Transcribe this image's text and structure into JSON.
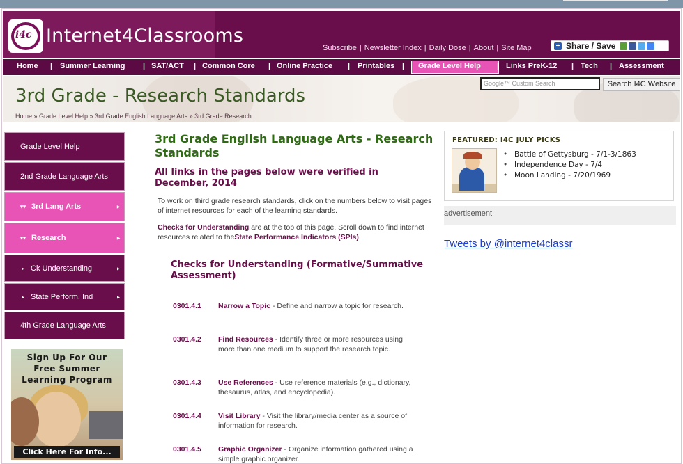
{
  "site": {
    "logo_mark": "i4c",
    "logo_text": "Internet4Classrooms"
  },
  "toplinks": [
    "Subscribe",
    "Newsletter Index",
    "Daily Dose",
    "About",
    "Site Map"
  ],
  "share_label": "Share / Save",
  "nav": [
    {
      "label": "Home",
      "active": false
    },
    {
      "label": "Summer Learning",
      "active": false
    },
    {
      "label": "SAT/ACT",
      "active": false
    },
    {
      "label": "Common Core",
      "active": false
    },
    {
      "label": "Online Practice",
      "active": false
    },
    {
      "label": "Printables",
      "active": false
    },
    {
      "label": "Grade Level Help",
      "active": true
    },
    {
      "label": "Links PreK-12",
      "active": false
    },
    {
      "label": "Tech",
      "active": false
    },
    {
      "label": "Assessment",
      "active": false
    }
  ],
  "banner": {
    "title": "3rd Grade - Research Standards",
    "breadcrumb": "Home » Grade Level Help » 3rd Grade English Language Arts » 3rd Grade Research",
    "search_placeholder": "Google™ Custom Search",
    "search_button": "Search I4C Website"
  },
  "sidebar": [
    {
      "label": "Grade Level Help",
      "style": "plain"
    },
    {
      "label": "2nd Grade Language Arts",
      "style": "plain"
    },
    {
      "label": "3rd Lang Arts",
      "style": "pink-expanded"
    },
    {
      "label": "Research",
      "style": "pink-expanded"
    },
    {
      "label": "Ck Understanding",
      "style": "sub"
    },
    {
      "label": "State Perform. Ind",
      "style": "sub"
    },
    {
      "label": "4th Grade Language Arts",
      "style": "plain"
    }
  ],
  "promo": {
    "line1": "Sign Up For Our",
    "line2": "Free Summer",
    "line3": "Learning Program",
    "cta": "Click Here For Info..."
  },
  "main": {
    "title": "3rd Grade English Language Arts - Research Standards",
    "verified": "All links in the pages below were verified in December, 2014",
    "intro": "To work on third grade research standards, click on the numbers below to visit pages of internet resources for each of the learning standards.",
    "note_prefix": "Checks for Understanding",
    "note_mid": " are at the top of this page. Scroll down to find internet resources related to the",
    "note_link": "State Performance Indicators (SPIs)",
    "note_end": ".",
    "section_title": "Checks for Understanding (Formative/Summative Assessment)",
    "standards": [
      {
        "code": "0301.4.1",
        "name": "Narrow a Topic",
        "desc": " - Define and narrow a topic for research."
      },
      {
        "code": "0301.4.2",
        "name": "Find Resources",
        "desc": " - Identify three or more resources using more than one medium to support the research topic."
      },
      {
        "code": "0301.4.3",
        "name": "Use References",
        "desc": " - Use reference materials (e.g., dictionary, thesaurus, atlas, and encyclopedia)."
      },
      {
        "code": "0301.4.4",
        "name": "Visit Library",
        "desc": " - Visit the library/media center as a source of information for research."
      },
      {
        "code": "0301.4.5",
        "name": "Graphic Organizer",
        "desc": " - Organize information gathered using a simple graphic organizer."
      }
    ]
  },
  "featured": {
    "title": "FEATURED: I4C JULY PICKS",
    "items": [
      "Battle of Gettysburg - 7/1-3/1863",
      "Independence Day - 7/4",
      "Moon Landing - 7/20/1969"
    ]
  },
  "ad_label": "advertisement",
  "tweets_link": "Tweets by @internet4classr"
}
